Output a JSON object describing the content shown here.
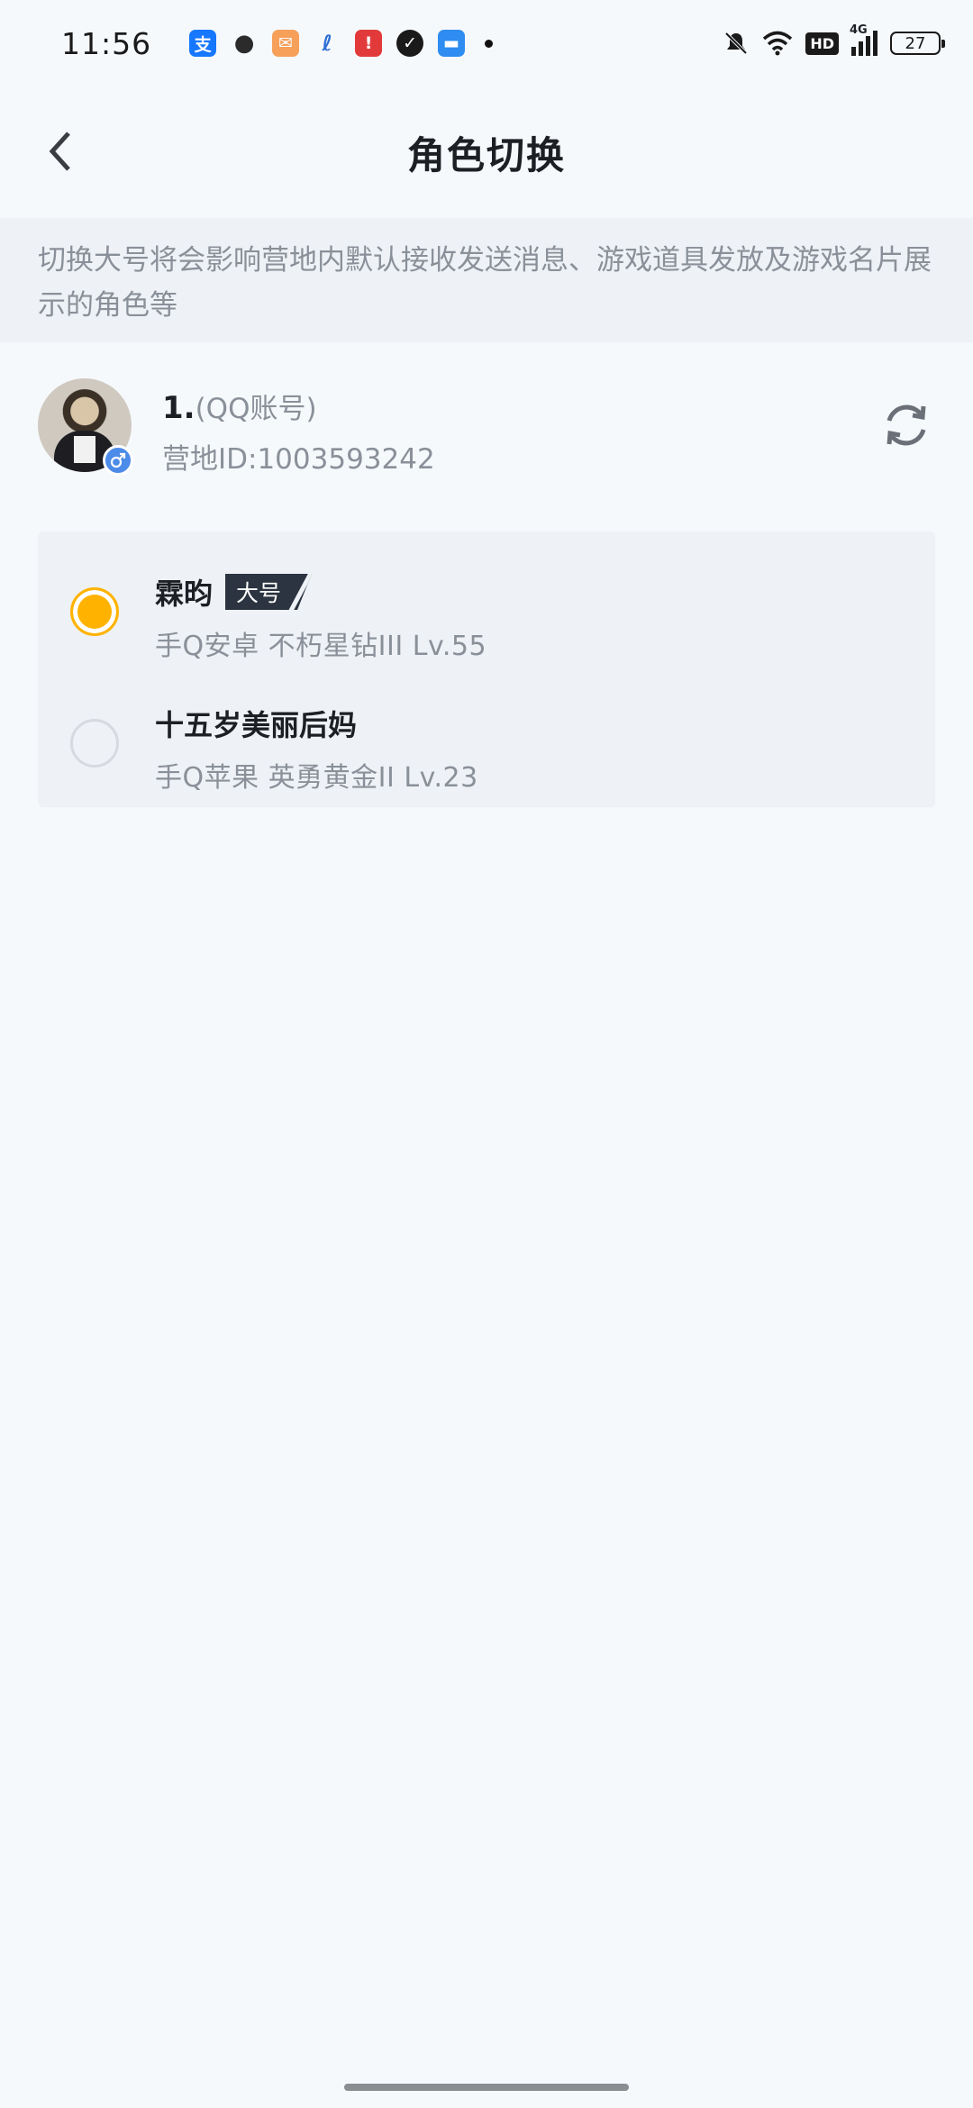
{
  "status_bar": {
    "time": "11:56",
    "apps": [
      {
        "icon": "alipay-icon",
        "glyph": "支",
        "color": "#1677ff"
      },
      {
        "icon": "wechat-icon",
        "glyph": "●",
        "color": "#2b2b2b"
      },
      {
        "icon": "mail-app-icon",
        "glyph": "✉",
        "color": "#f08a3c"
      },
      {
        "icon": "china-telecom-icon",
        "glyph": "ℓ",
        "color": "#2f6fd6"
      },
      {
        "icon": "red-app-icon",
        "glyph": "!",
        "color": "#e23a3a"
      },
      {
        "icon": "shield-app-icon",
        "glyph": "✓",
        "color": "#1a1a1a"
      },
      {
        "icon": "files-app-icon",
        "glyph": "▬",
        "color": "#2f8cf0"
      }
    ],
    "hd_label": "HD",
    "network_label": "4G",
    "battery": "27"
  },
  "header": {
    "title": "角色切换"
  },
  "notice": {
    "text": "切换大号将会影响营地内默认接收发送消息、游戏道具发放及游戏名片展示的角色等"
  },
  "account": {
    "number": "1.",
    "type": "(QQ账号)",
    "camp_id": "营地ID:1003593242"
  },
  "roles": [
    {
      "name": "霖昀",
      "tag": "大号",
      "detail": "手Q安卓  不朽星钻III  Lv.55",
      "selected": true
    },
    {
      "name": "十五岁美丽后妈",
      "detail": "手Q苹果  英勇黄金II  Lv.23",
      "selected": false
    }
  ],
  "colors": {
    "accent": "#ffb300",
    "background": "#f6f9fc",
    "card": "#eef1f5",
    "secondary_text": "#8a9099"
  }
}
